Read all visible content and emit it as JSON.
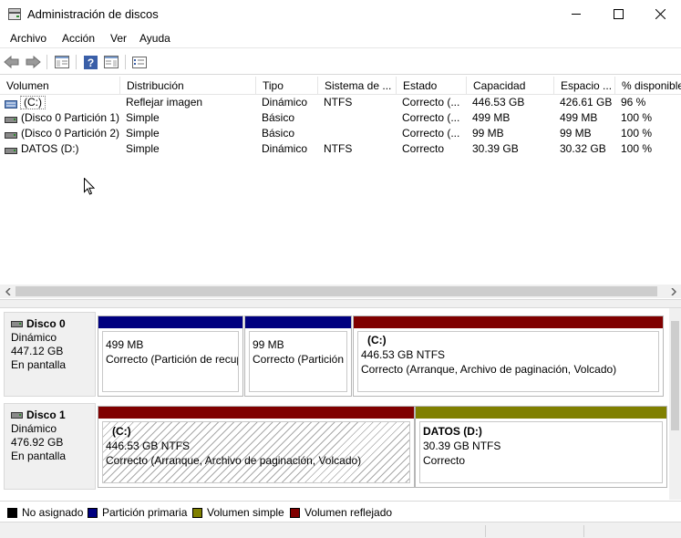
{
  "window": {
    "title": "Administración de discos",
    "minimize_glyph": "minimize-icon",
    "maximize_glyph": "maximize-icon",
    "close_glyph": "close-icon"
  },
  "menu": [
    "Archivo",
    "Acción",
    "Ver",
    "Ayuda"
  ],
  "table": {
    "columns": [
      "Volumen",
      "Distribución",
      "Tipo",
      "Sistema de ...",
      "Estado",
      "Capacidad",
      "Espacio ...",
      "% disponible"
    ],
    "rows": [
      {
        "volume": "(C:)",
        "layout": "Reflejar imagen",
        "type": "Dinámico",
        "fs": "NTFS",
        "status": "Correcto (...",
        "capacity": "446.53 GB",
        "free": "426.61 GB",
        "pct": "96 %",
        "icon": "mirrored-volume-icon"
      },
      {
        "volume": "(Disco 0 Partición 1)",
        "layout": "Simple",
        "type": "Básico",
        "fs": "",
        "status": "Correcto (...",
        "capacity": "499 MB",
        "free": "499 MB",
        "pct": "100 %",
        "icon": "simple-volume-icon"
      },
      {
        "volume": "(Disco 0 Partición 2)",
        "layout": "Simple",
        "type": "Básico",
        "fs": "",
        "status": "Correcto (...",
        "capacity": "99 MB",
        "free": "99 MB",
        "pct": "100 %",
        "icon": "simple-volume-icon"
      },
      {
        "volume": "DATOS (D:)",
        "layout": "Simple",
        "type": "Dinámico",
        "fs": "NTFS",
        "status": "Correcto",
        "capacity": "30.39 GB",
        "free": "30.32 GB",
        "pct": "100 %",
        "icon": "simple-volume-icon"
      }
    ]
  },
  "disks": [
    {
      "name": "Disco 0",
      "kind": "Dinámico",
      "size": "447.12 GB",
      "state": "En pantalla",
      "partitions": [
        {
          "title": "",
          "line1": "499 MB",
          "line2": "Correcto (Partición de recuperación)",
          "color": "#000080"
        },
        {
          "title": "",
          "line1": "99 MB",
          "line2": "Correcto (Partición de sistema EFI)",
          "color": "#000080"
        },
        {
          "title": "(C:)",
          "line1": "446.53 GB NTFS",
          "line2": "Correcto (Arranque, Archivo de paginación, Volcado)",
          "color": "#800000"
        }
      ]
    },
    {
      "name": "Disco 1",
      "kind": "Dinámico",
      "size": "476.92 GB",
      "state": "En pantalla",
      "partitions": [
        {
          "title": "(C:)",
          "line1": "446.53 GB NTFS",
          "line2": "Correcto (Arranque, Archivo de paginación, Volcado)",
          "color": "#800000"
        },
        {
          "title": "DATOS  (D:)",
          "line1": "30.39 GB NTFS",
          "line2": "Correcto",
          "color": "#808000"
        }
      ]
    }
  ],
  "legend": [
    {
      "label": "No asignado",
      "color": "#000000"
    },
    {
      "label": "Partición primaria",
      "color": "#000080"
    },
    {
      "label": "Volumen simple",
      "color": "#808000"
    },
    {
      "label": "Volumen reflejado",
      "color": "#800000"
    }
  ]
}
